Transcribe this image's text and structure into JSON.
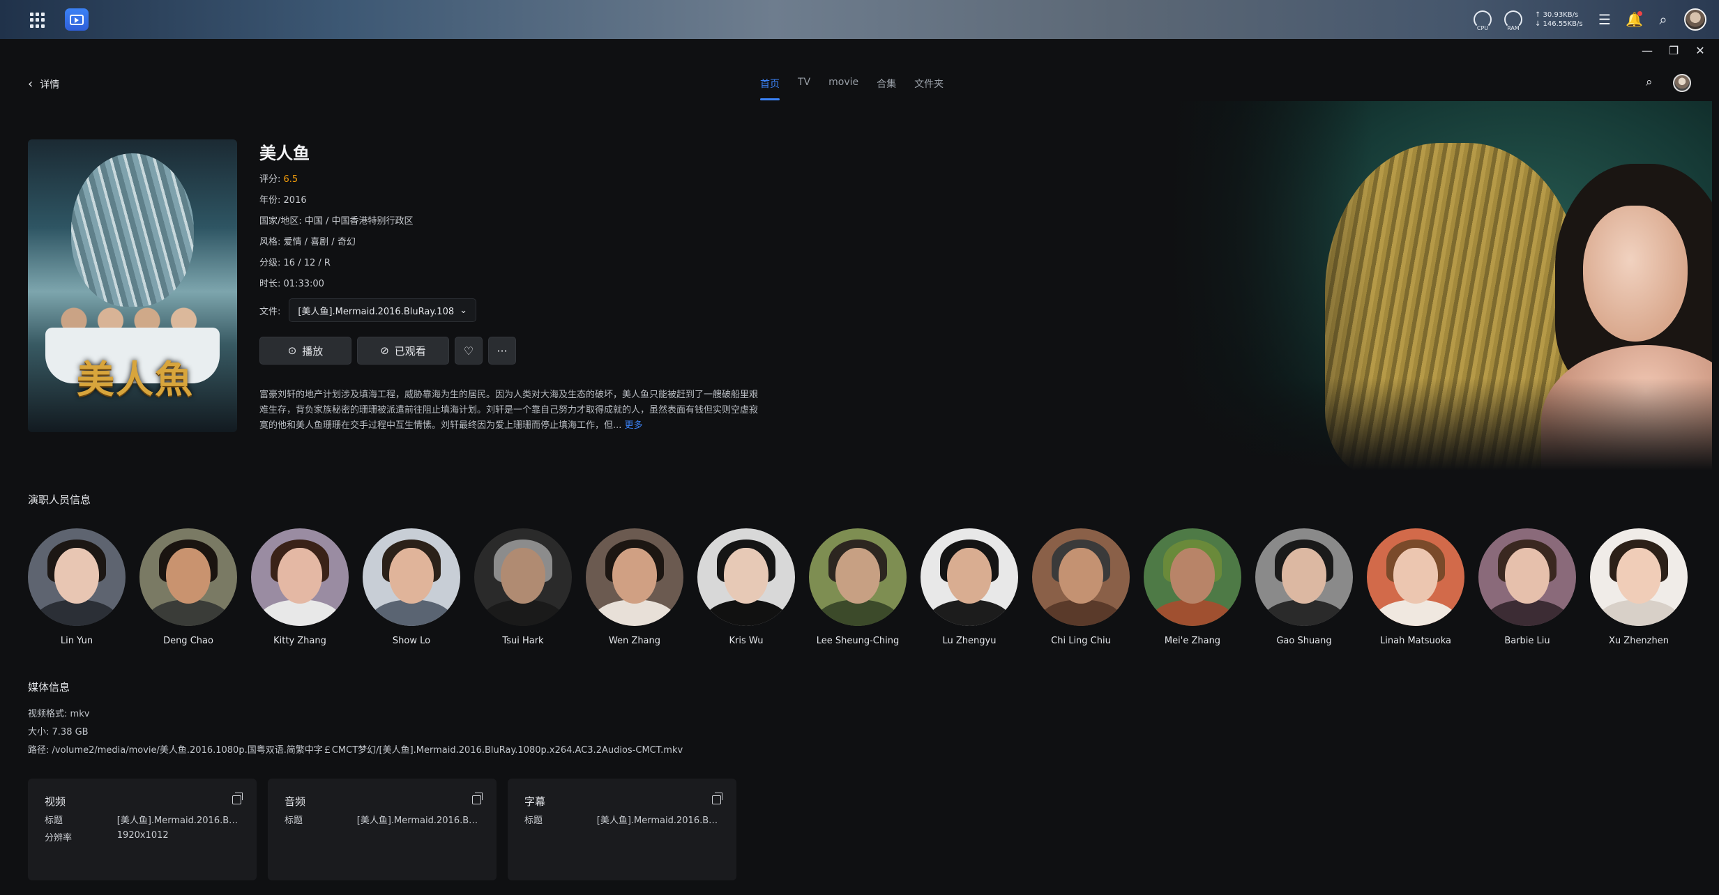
{
  "system": {
    "cpu_label": "CPU",
    "ram_label": "RAM",
    "net_up": "↑ 30.93KB/s",
    "net_down": "↓ 146.55KB/s"
  },
  "header": {
    "back_label": "详情",
    "tabs": [
      {
        "label": "首页",
        "active": true
      },
      {
        "label": "TV",
        "active": false
      },
      {
        "label": "movie",
        "active": false
      },
      {
        "label": "合集",
        "active": false
      },
      {
        "label": "文件夹",
        "active": false
      }
    ]
  },
  "movie": {
    "poster_text": "美人魚",
    "title": "美人鱼",
    "rating_label": "评分:",
    "rating": "6.5",
    "year_label": "年份:",
    "year": "2016",
    "region_label": "国家/地区:",
    "region": "中国 / 中国香港特别行政区",
    "genre_label": "风格:",
    "genre": "爱情 / 喜剧 / 奇幻",
    "rating_class_label": "分级:",
    "rating_class": "16 / 12 / R",
    "duration_label": "时长:",
    "duration": "01:33:00",
    "file_label": "文件:",
    "file_value": "[美人鱼].Mermaid.2016.BluRay.108",
    "play_label": "播放",
    "watched_label": "已观看",
    "description": "富豪刘轩的地产计划涉及填海工程，威胁靠海为生的居民。因为人类对大海及生态的破坏，美人鱼只能被赶到了一艘破船里艰难生存，背负家族秘密的珊珊被派遣前往阻止填海计划。刘轩是一个靠自己努力才取得成就的人，虽然表面有钱但实则空虚寂寞的他和美人鱼珊珊在交手过程中互生情愫。刘轩最终因为爱上珊珊而停止填海工作，但...",
    "more_label": "更多"
  },
  "cast": {
    "title": "演职人员信息",
    "people": [
      {
        "name": "Lin Yun",
        "skin": "#e8c6b3",
        "hair": "#1c1714",
        "bg": "#5e6470",
        "cloth": "#2b2f36"
      },
      {
        "name": "Deng Chao",
        "skin": "#c9936f",
        "hair": "#1a1410",
        "bg": "#7a7a64",
        "cloth": "#3a3c38"
      },
      {
        "name": "Kitty Zhang",
        "skin": "#e4b8a4",
        "hair": "#3a2218",
        "bg": "#9a8ca2",
        "cloth": "#e8e8e8"
      },
      {
        "name": "Show Lo",
        "skin": "#e0b49a",
        "hair": "#2b2119",
        "bg": "#c8ced6",
        "cloth": "#5a6472"
      },
      {
        "name": "Tsui Hark",
        "skin": "#b08b72",
        "hair": "#8c8c8c",
        "bg": "#2a2a2a",
        "cloth": "#1a1a1a"
      },
      {
        "name": "Wen Zhang",
        "skin": "#d0a083",
        "hair": "#1c1612",
        "bg": "#6b5a50",
        "cloth": "#e8e0d8"
      },
      {
        "name": "Kris Wu",
        "skin": "#e7c9b6",
        "hair": "#151515",
        "bg": "#d8d8d8",
        "cloth": "#111111"
      },
      {
        "name": "Lee Sheung-Ching",
        "skin": "#c7a083",
        "hair": "#2c2620",
        "bg": "#7e8e52",
        "cloth": "#3c4a2a"
      },
      {
        "name": "Lu Zhengyu",
        "skin": "#d9ad91",
        "hair": "#141414",
        "bg": "#e8e8e8",
        "cloth": "#1c1c1c"
      },
      {
        "name": "Chi Ling Chiu",
        "skin": "#c49272",
        "hair": "#3a3a3a",
        "bg": "#8a6048",
        "cloth": "#5a3a2a"
      },
      {
        "name": "Mei'e Zhang",
        "skin": "#b88468",
        "hair": "#6a8a3a",
        "bg": "#4e7a46",
        "cloth": "#a05030"
      },
      {
        "name": "Gao Shuang",
        "skin": "#dcb8a2",
        "hair": "#1a1a1a",
        "bg": "#8a8a8a",
        "cloth": "#2a2a2a"
      },
      {
        "name": "Linah Matsuoka",
        "skin": "#ecc6b0",
        "hair": "#7a4a2a",
        "bg": "#d26a4a",
        "cloth": "#f0e8e0"
      },
      {
        "name": "Barbie Liu",
        "skin": "#e6c0ac",
        "hair": "#3a2820",
        "bg": "#8a6a7a",
        "cloth": "#3c2c34"
      },
      {
        "name": "Xu Zhenzhen",
        "skin": "#f0cdb8",
        "hair": "#2c2018",
        "bg": "#f0ece8",
        "cloth": "#d8d0c8"
      }
    ]
  },
  "media": {
    "title": "媒体信息",
    "format_label": "视频格式:",
    "format": "mkv",
    "size_label": "大小:",
    "size": "7.38 GB",
    "path_label": "路径:",
    "path": "/volume2/media/movie/美人鱼.2016.1080p.国粤双语.简繁中字￡CMCT梦幻/[美人鱼].Mermaid.2016.BluRay.1080p.x264.AC3.2Audios-CMCT.mkv",
    "cards": [
      {
        "title": "视频",
        "rows": [
          {
            "k": "标题",
            "v": "[美人鱼].Mermaid.2016.Bl..."
          },
          {
            "k": "分辨率",
            "v": "1920x1012"
          }
        ]
      },
      {
        "title": "音频",
        "rows": [
          {
            "k": "标题",
            "v": "[美人鱼].Mermaid.2016.Bl..."
          }
        ]
      },
      {
        "title": "字幕",
        "rows": [
          {
            "k": "标题",
            "v": "[美人鱼].Mermaid.2016.Bl..."
          }
        ]
      }
    ]
  },
  "colors": {
    "accent": "#3b82f6",
    "rating": "#f59e0b",
    "background": "#0f1012"
  }
}
